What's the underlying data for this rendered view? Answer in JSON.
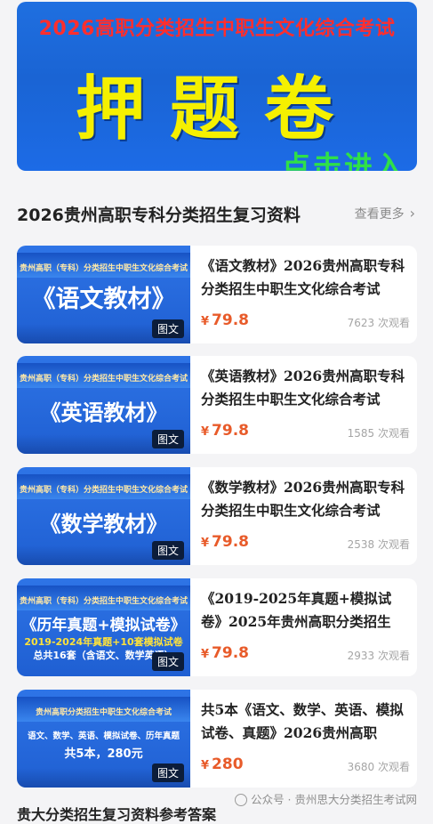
{
  "banner": {
    "top_title": "2026高职分类招生中职生文化综合考试",
    "big_title": "押题卷",
    "enter_label": "点击进入"
  },
  "section": {
    "title": "2026贵州高职专科分类招生复习资料",
    "more_label": "查看更多",
    "chevron_glyph": "›"
  },
  "items": [
    {
      "thumb_small": "贵州高职（专科）分类招生中职生文化综合考试",
      "thumb_big": "《语文教材》",
      "thumb_line2": "",
      "thumb_line3": "",
      "tag": "图文",
      "title": "《语文教材》2026贵州高职专科分类招生中职生文化综合考试",
      "yen": "¥",
      "price": "79.8",
      "views": "7623 次观看"
    },
    {
      "thumb_small": "贵州高职（专科）分类招生中职生文化综合考试",
      "thumb_big": "《英语教材》",
      "thumb_line2": "",
      "thumb_line3": "",
      "tag": "图文",
      "title": "《英语教材》2026贵州高职专科分类招生中职生文化综合考试",
      "yen": "¥",
      "price": "79.8",
      "views": "1585 次观看"
    },
    {
      "thumb_small": "贵州高职（专科）分类招生中职生文化综合考试",
      "thumb_big": "《数学教材》",
      "thumb_line2": "",
      "thumb_line3": "",
      "tag": "图文",
      "title": "《数学教材》2026贵州高职专科分类招生中职生文化综合考试",
      "yen": "¥",
      "price": "79.8",
      "views": "2538 次观看"
    },
    {
      "thumb_small": "贵州高职（专科）分类招生中职生文化综合考试",
      "thumb_big": "《历年真题+模拟试卷》",
      "thumb_line2": "2019-2024年真题+10套模拟试卷",
      "thumb_line3": "总共16套（含语文、数学英语）",
      "tag": "图文",
      "title": "《2019-2025年真题+模拟试卷》2025年贵州高职分类招生",
      "yen": "¥",
      "price": "79.8",
      "views": "2933 次观看"
    },
    {
      "thumb_small": "贵州高职分类招生中职生文化综合考试",
      "thumb_big": "",
      "thumb_line2": "语文、数学、英语、模拟试卷、历年真题",
      "thumb_line3": "共5本，280元",
      "tag": "图文",
      "title": "共5本《语文、数学、英语、模拟试卷、真题》2026贵州高职",
      "yen": "¥",
      "price": "280",
      "views": "3680 次观看"
    }
  ],
  "footer": {
    "partial_heading": "贵大分类招生复习资料参考答案",
    "watermark": "公众号 · 贵州思大分类招生考试网"
  },
  "colors": {
    "price": "#e85b2a",
    "banner_blue": "#1f6fe0",
    "banner_yellow": "#f5f000",
    "banner_red": "#ff2e2e",
    "banner_green": "#2fe048"
  }
}
